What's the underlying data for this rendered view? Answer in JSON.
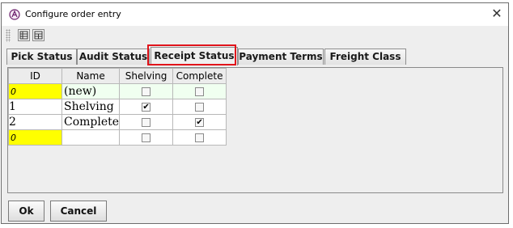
{
  "window": {
    "title": "Configure order entry",
    "close_glyph": "✕"
  },
  "tabs": [
    {
      "label": "Pick Status"
    },
    {
      "label": "Audit Status"
    },
    {
      "label": "Receipt Status",
      "active": true
    },
    {
      "label": "Payment Terms"
    },
    {
      "label": "Freight Class"
    }
  ],
  "table": {
    "columns": [
      "ID",
      "Name",
      "Shelving",
      "Complete"
    ],
    "rows": [
      {
        "id": "0",
        "name": "(new)",
        "shelving": false,
        "complete": false
      },
      {
        "id": "1",
        "name": "Shelving",
        "shelving": true,
        "complete": false
      },
      {
        "id": "2",
        "name": "Complete",
        "shelving": false,
        "complete": true
      },
      {
        "id": "0",
        "name": "",
        "shelving": false,
        "complete": false
      }
    ]
  },
  "buttons": {
    "ok": "Ok",
    "cancel": "Cancel"
  },
  "check_mark": "✔",
  "colors": {
    "highlight": "#e1141b",
    "id_new": "#ffff00",
    "new_row": "#f0fff0"
  }
}
